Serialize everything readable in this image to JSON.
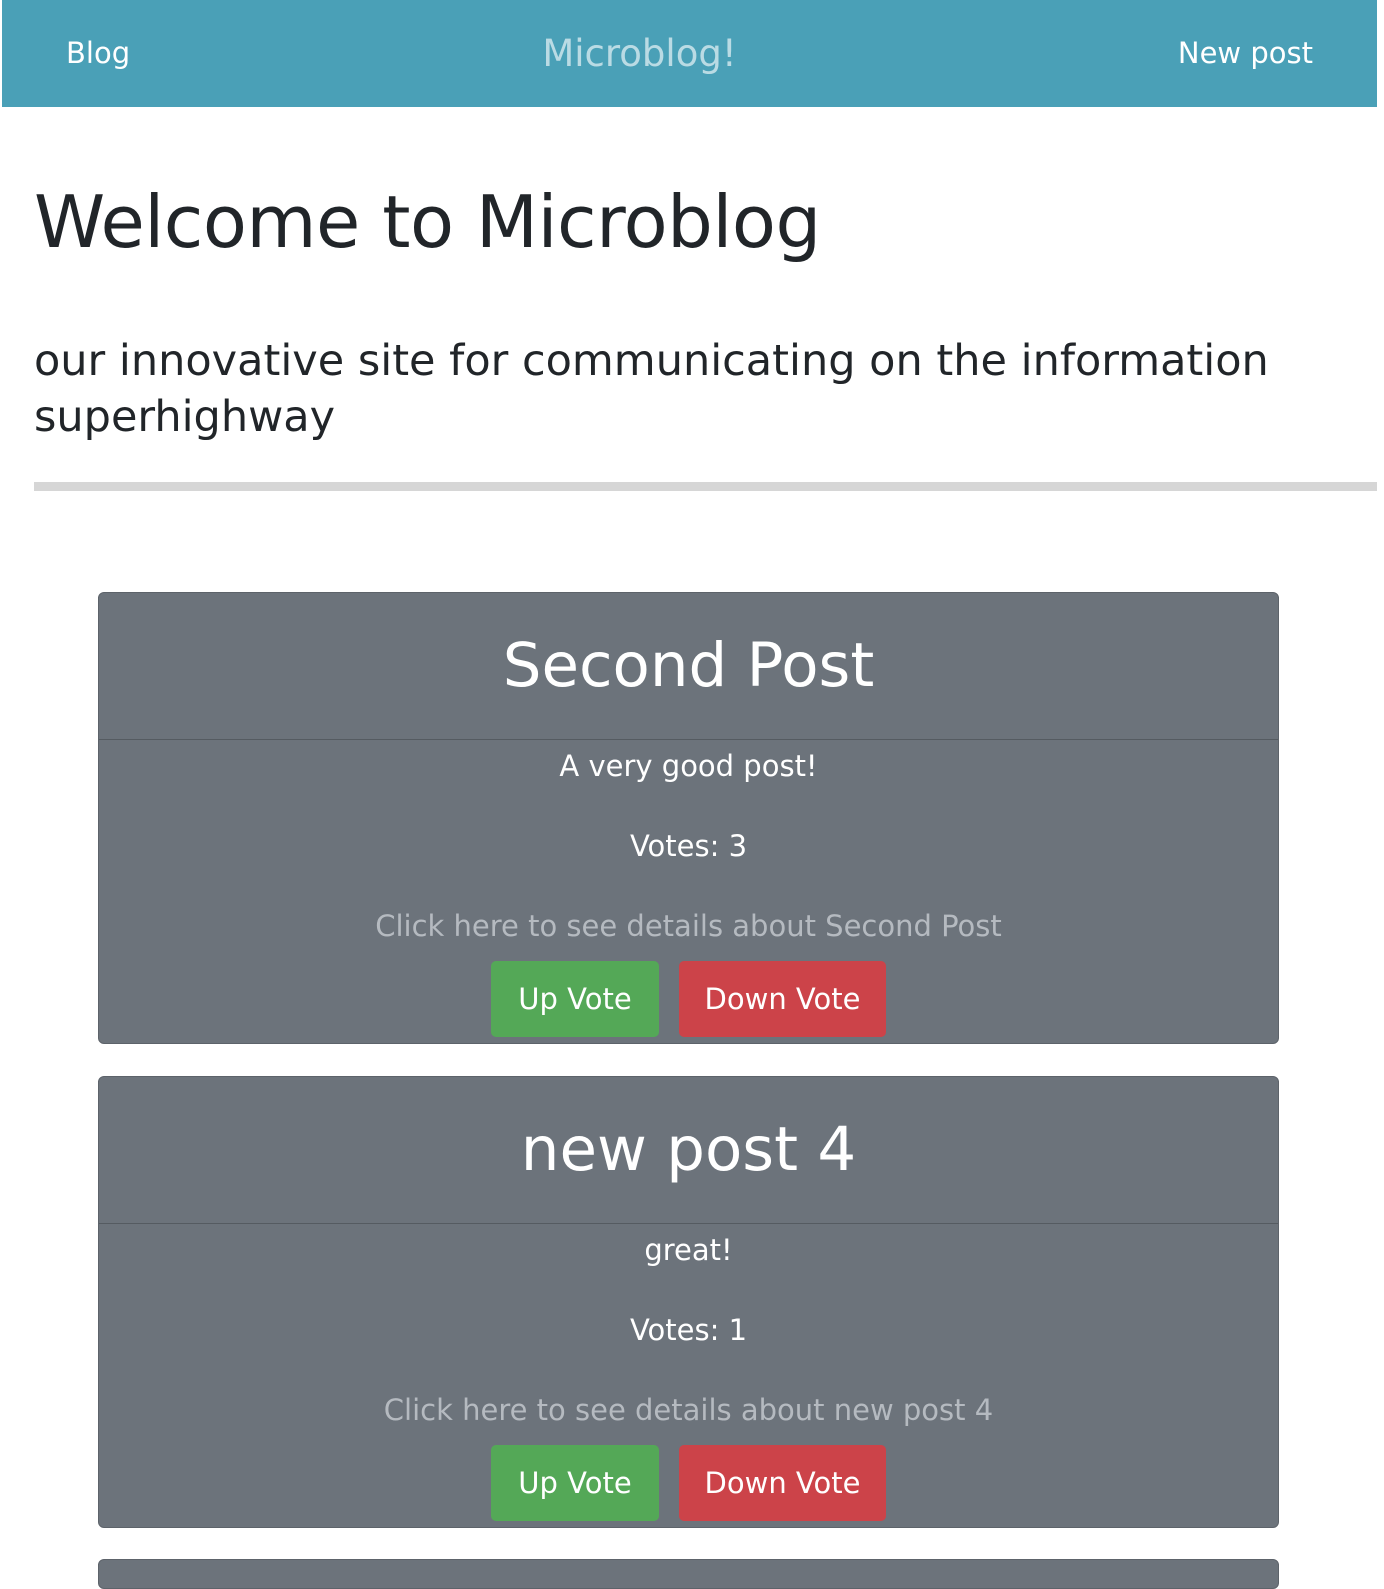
{
  "navbar": {
    "blog_label": "Blog",
    "brand": "Microblog!",
    "new_post_label": "New post"
  },
  "hero": {
    "title": "Welcome to Microblog",
    "lead": "our innovative site for communicating on the information superhighway"
  },
  "posts": [
    {
      "title": "Second Post",
      "text": "A very good post!",
      "votes": "Votes: 3",
      "details_link": "Click here to see details about Second Post",
      "upvote_label": "Up Vote",
      "downvote_label": "Down Vote"
    },
    {
      "title": "new post 4",
      "text": "great!",
      "votes": "Votes: 1",
      "details_link": "Click here to see details about new post 4",
      "upvote_label": "Up Vote",
      "downvote_label": "Down Vote"
    }
  ],
  "colors": {
    "navbar": "#4aa0b7",
    "card": "#6c737b",
    "upvote": "#54a857",
    "downvote": "#cc4349"
  }
}
